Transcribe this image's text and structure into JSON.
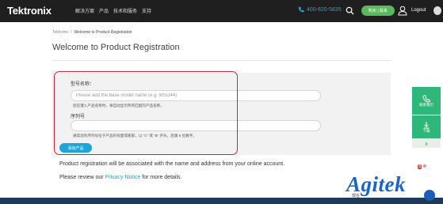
{
  "header": {
    "logo": "Tektronix",
    "nav": [
      "解决方案",
      "产品",
      "技术和服务",
      "支持"
    ],
    "phone": "400-820-5835",
    "pill_label": "购买 | 联系",
    "logout": "Logout"
  },
  "breadcrumb": {
    "home": "Tektronix",
    "sep": "/",
    "current": "Welcome to Product Registration"
  },
  "page_title": "Welcome to Product Registration",
  "form": {
    "model_label": "型号名称：",
    "model_placeholder": "Please add the base model name (e.g. MSO44)",
    "model_hint": "您在键入产品名称时，将自动显示所有匹配的产品名称。",
    "serial_label": "序列号",
    "serial_placeholder": "",
    "serial_hint": "通常您的序列号位于产品的背面或底部，以 “C” 或 “B” 开头，后跟 6 位数字。",
    "add_button": "添加产品"
  },
  "notes": {
    "line1": "Product registration will be associated with the name and address from your online account.",
    "line2_before": "Please review our",
    "line2_link": "Privacy Notice",
    "line2_after": "for more details."
  },
  "side_widget": {
    "contact": "联系我们",
    "download": "下载"
  },
  "overlay": {
    "brand": "Agitek",
    "chat": "现在",
    "so_badge": "中"
  },
  "colors": {
    "accent_blue": "#1ba5d8",
    "highlight_red": "#c9283a",
    "side_green": "#2fb77a",
    "header_bg": "#1f1f1f"
  }
}
